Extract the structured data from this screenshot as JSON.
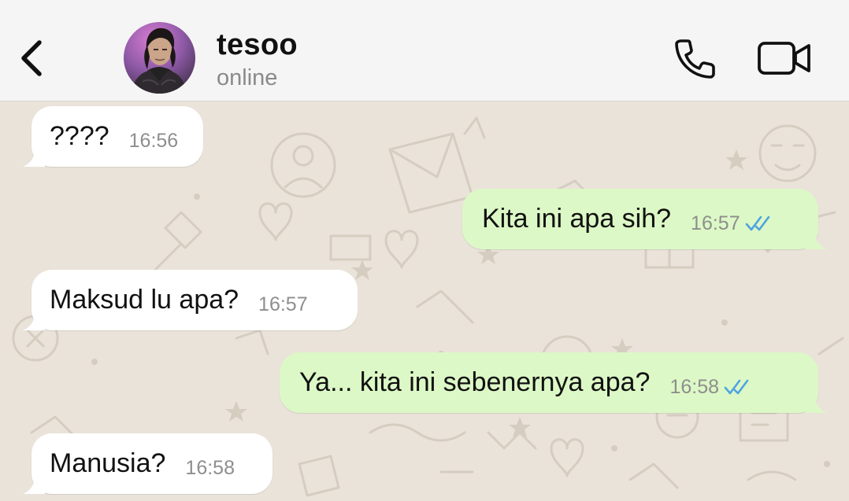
{
  "header": {
    "contact_name": "tesoo",
    "status": "online",
    "icons": [
      "back-chevron-icon",
      "phone-icon",
      "video-camera-icon"
    ]
  },
  "messages": [
    {
      "direction": "incoming",
      "text": "????",
      "time": "16:56"
    },
    {
      "direction": "outgoing",
      "text": "Kita ini apa sih?",
      "time": "16:57",
      "status": "read"
    },
    {
      "direction": "incoming",
      "text": "Maksud lu apa?",
      "time": "16:57"
    },
    {
      "direction": "outgoing",
      "text": "Ya... kita ini sebenernya apa?",
      "time": "16:58",
      "status": "read"
    },
    {
      "direction": "incoming",
      "text": "Manusia?",
      "time": "16:58"
    }
  ],
  "colors": {
    "header_bg": "#f5f5f5",
    "chat_bg": "#eae3da",
    "incoming_bubble": "#ffffff",
    "outgoing_bubble": "#dcf8c6",
    "read_ticks": "#4fa3e0"
  }
}
